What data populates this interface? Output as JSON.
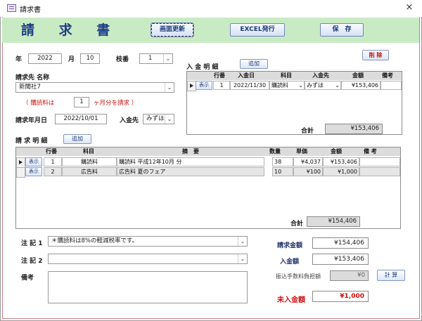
{
  "window": {
    "title": "請求書",
    "close": "×"
  },
  "header": {
    "title": "請 求 書",
    "btn_refresh": "画面更新",
    "btn_excel": "EXCEL発行",
    "btn_save": "保　存"
  },
  "form": {
    "year_label": "年",
    "year_value": "2022",
    "month_label": "月",
    "month_value": "10",
    "branch_label": "枝番",
    "branch_value": "1",
    "delete_btn": "削 除",
    "customer_label": "請求先 名称",
    "customer_value": "新聞社7",
    "sub_prefix": "（ 購読料は",
    "sub_months": "1",
    "sub_suffix": "ヶ月分を請求 ）",
    "date_label": "請求年月日",
    "date_value": "2022/10/01",
    "payee_label": "入金先",
    "payee_value": "みずほ"
  },
  "payments": {
    "title": "入 金 明 細",
    "add_btn": "追加",
    "headers": [
      "行番",
      "入金日",
      "科目",
      "入金先",
      "金額",
      "備考"
    ],
    "rows": [
      {
        "show": "表示",
        "no": "1",
        "date": "2022/11/30",
        "subject": "購読料",
        "payee": "みずほ",
        "amount": "¥153,406",
        "note": ""
      }
    ],
    "total_label": "合計",
    "total_value": "¥153,406"
  },
  "details": {
    "title": "請 求 明 細",
    "add_btn": "追加",
    "headers": [
      "行番",
      "科目",
      "摘　要",
      "数量",
      "単価",
      "金額",
      "備 考"
    ],
    "rows": [
      {
        "show": "表示",
        "no": "1",
        "subject": "購読料",
        "desc": "購読料  平成12年10月 分",
        "qty": "38",
        "price": "¥4,037",
        "amount": "¥153,406",
        "note": ""
      },
      {
        "show": "表示",
        "no": "2",
        "subject": "広告料",
        "desc": "広告料 夏のフェア",
        "qty": "10",
        "price": "¥100",
        "amount": "¥1,000",
        "note": ""
      }
    ],
    "total_label": "合計",
    "total_value": "¥154,406"
  },
  "notes": {
    "note1_label": "注 記 1",
    "note1_value": "＊購読料は8%の軽減税率です。",
    "note2_label": "注 記 2",
    "note2_value": "",
    "remarks_label": "備考"
  },
  "summary": {
    "billing_label": "請求金額",
    "billing_value": "¥154,406",
    "received_label": "入金額",
    "received_value": "¥153,406",
    "fee_label": "振込手数料負担額",
    "fee_value": "¥0",
    "calc_btn": "計 算",
    "unpaid_label": "未入金額",
    "unpaid_value": "¥1,000"
  },
  "icons": {
    "dropdown": "chevron-down-icon",
    "row_selector": "triangle-right-icon"
  }
}
